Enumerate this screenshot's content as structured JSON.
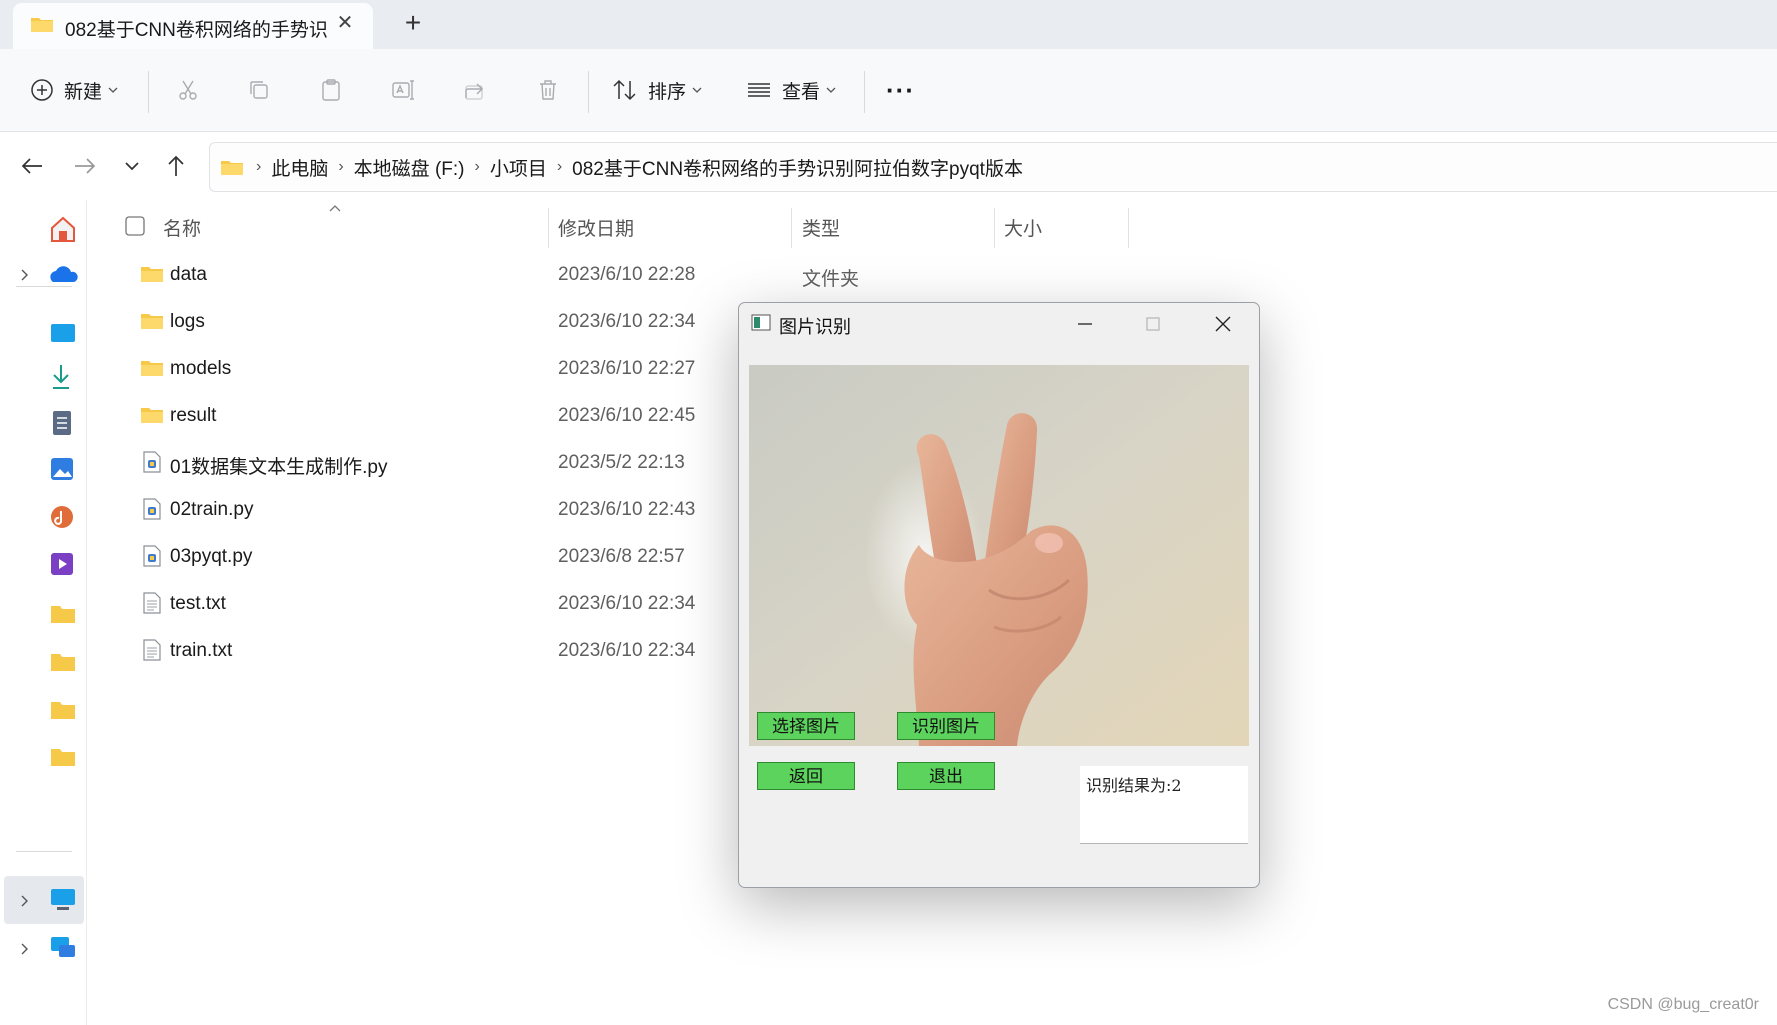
{
  "tab": {
    "title": "082基于CNN卷积网络的手势识",
    "close_symbol": "✕",
    "new_tab_symbol": "+"
  },
  "toolbar": {
    "new_label": "新建",
    "sort_label": "排序",
    "view_label": "查看",
    "more_label": "···"
  },
  "address": {
    "crumbs": [
      "此电脑",
      "本地磁盘 (F:)",
      "小项目",
      "082基于CNN卷积网络的手势识别阿拉伯数字pyqt版本"
    ],
    "separator": "›"
  },
  "columns": {
    "name": "名称",
    "date": "修改日期",
    "type": "类型",
    "size": "大小"
  },
  "files": [
    {
      "name": "data",
      "date": "2023/6/10 22:28",
      "type": "文件夹",
      "icon": "folder-icon"
    },
    {
      "name": "logs",
      "date": "2023/6/10 22:34",
      "type": "",
      "icon": "folder-icon"
    },
    {
      "name": "models",
      "date": "2023/6/10 22:27",
      "type": "",
      "icon": "folder-icon"
    },
    {
      "name": "result",
      "date": "2023/6/10 22:45",
      "type": "",
      "icon": "folder-icon"
    },
    {
      "name": "01数据集文本生成制作.py",
      "date": "2023/5/2 22:13",
      "type": "",
      "icon": "python-file-icon"
    },
    {
      "name": "02train.py",
      "date": "2023/6/10 22:43",
      "type": "",
      "icon": "python-file-icon"
    },
    {
      "name": "03pyqt.py",
      "date": "2023/6/8 22:57",
      "type": "",
      "icon": "python-file-icon"
    },
    {
      "name": "test.txt",
      "date": "2023/6/10 22:34",
      "type": "",
      "icon": "text-file-icon"
    },
    {
      "name": "train.txt",
      "date": "2023/6/10 22:34",
      "type": "",
      "icon": "text-file-icon"
    }
  ],
  "dialog": {
    "title": "图片识别",
    "select_button": "选择图片",
    "recognize_button": "识别图片",
    "back_button": "返回",
    "exit_button": "退出",
    "result_text": "识别结果为:2"
  },
  "watermark": "CSDN @bug_creat0r",
  "colors": {
    "accent_green": "#5cd35c",
    "folder_yellow": "#f7c948",
    "tab_bg": "#e9edf2"
  }
}
